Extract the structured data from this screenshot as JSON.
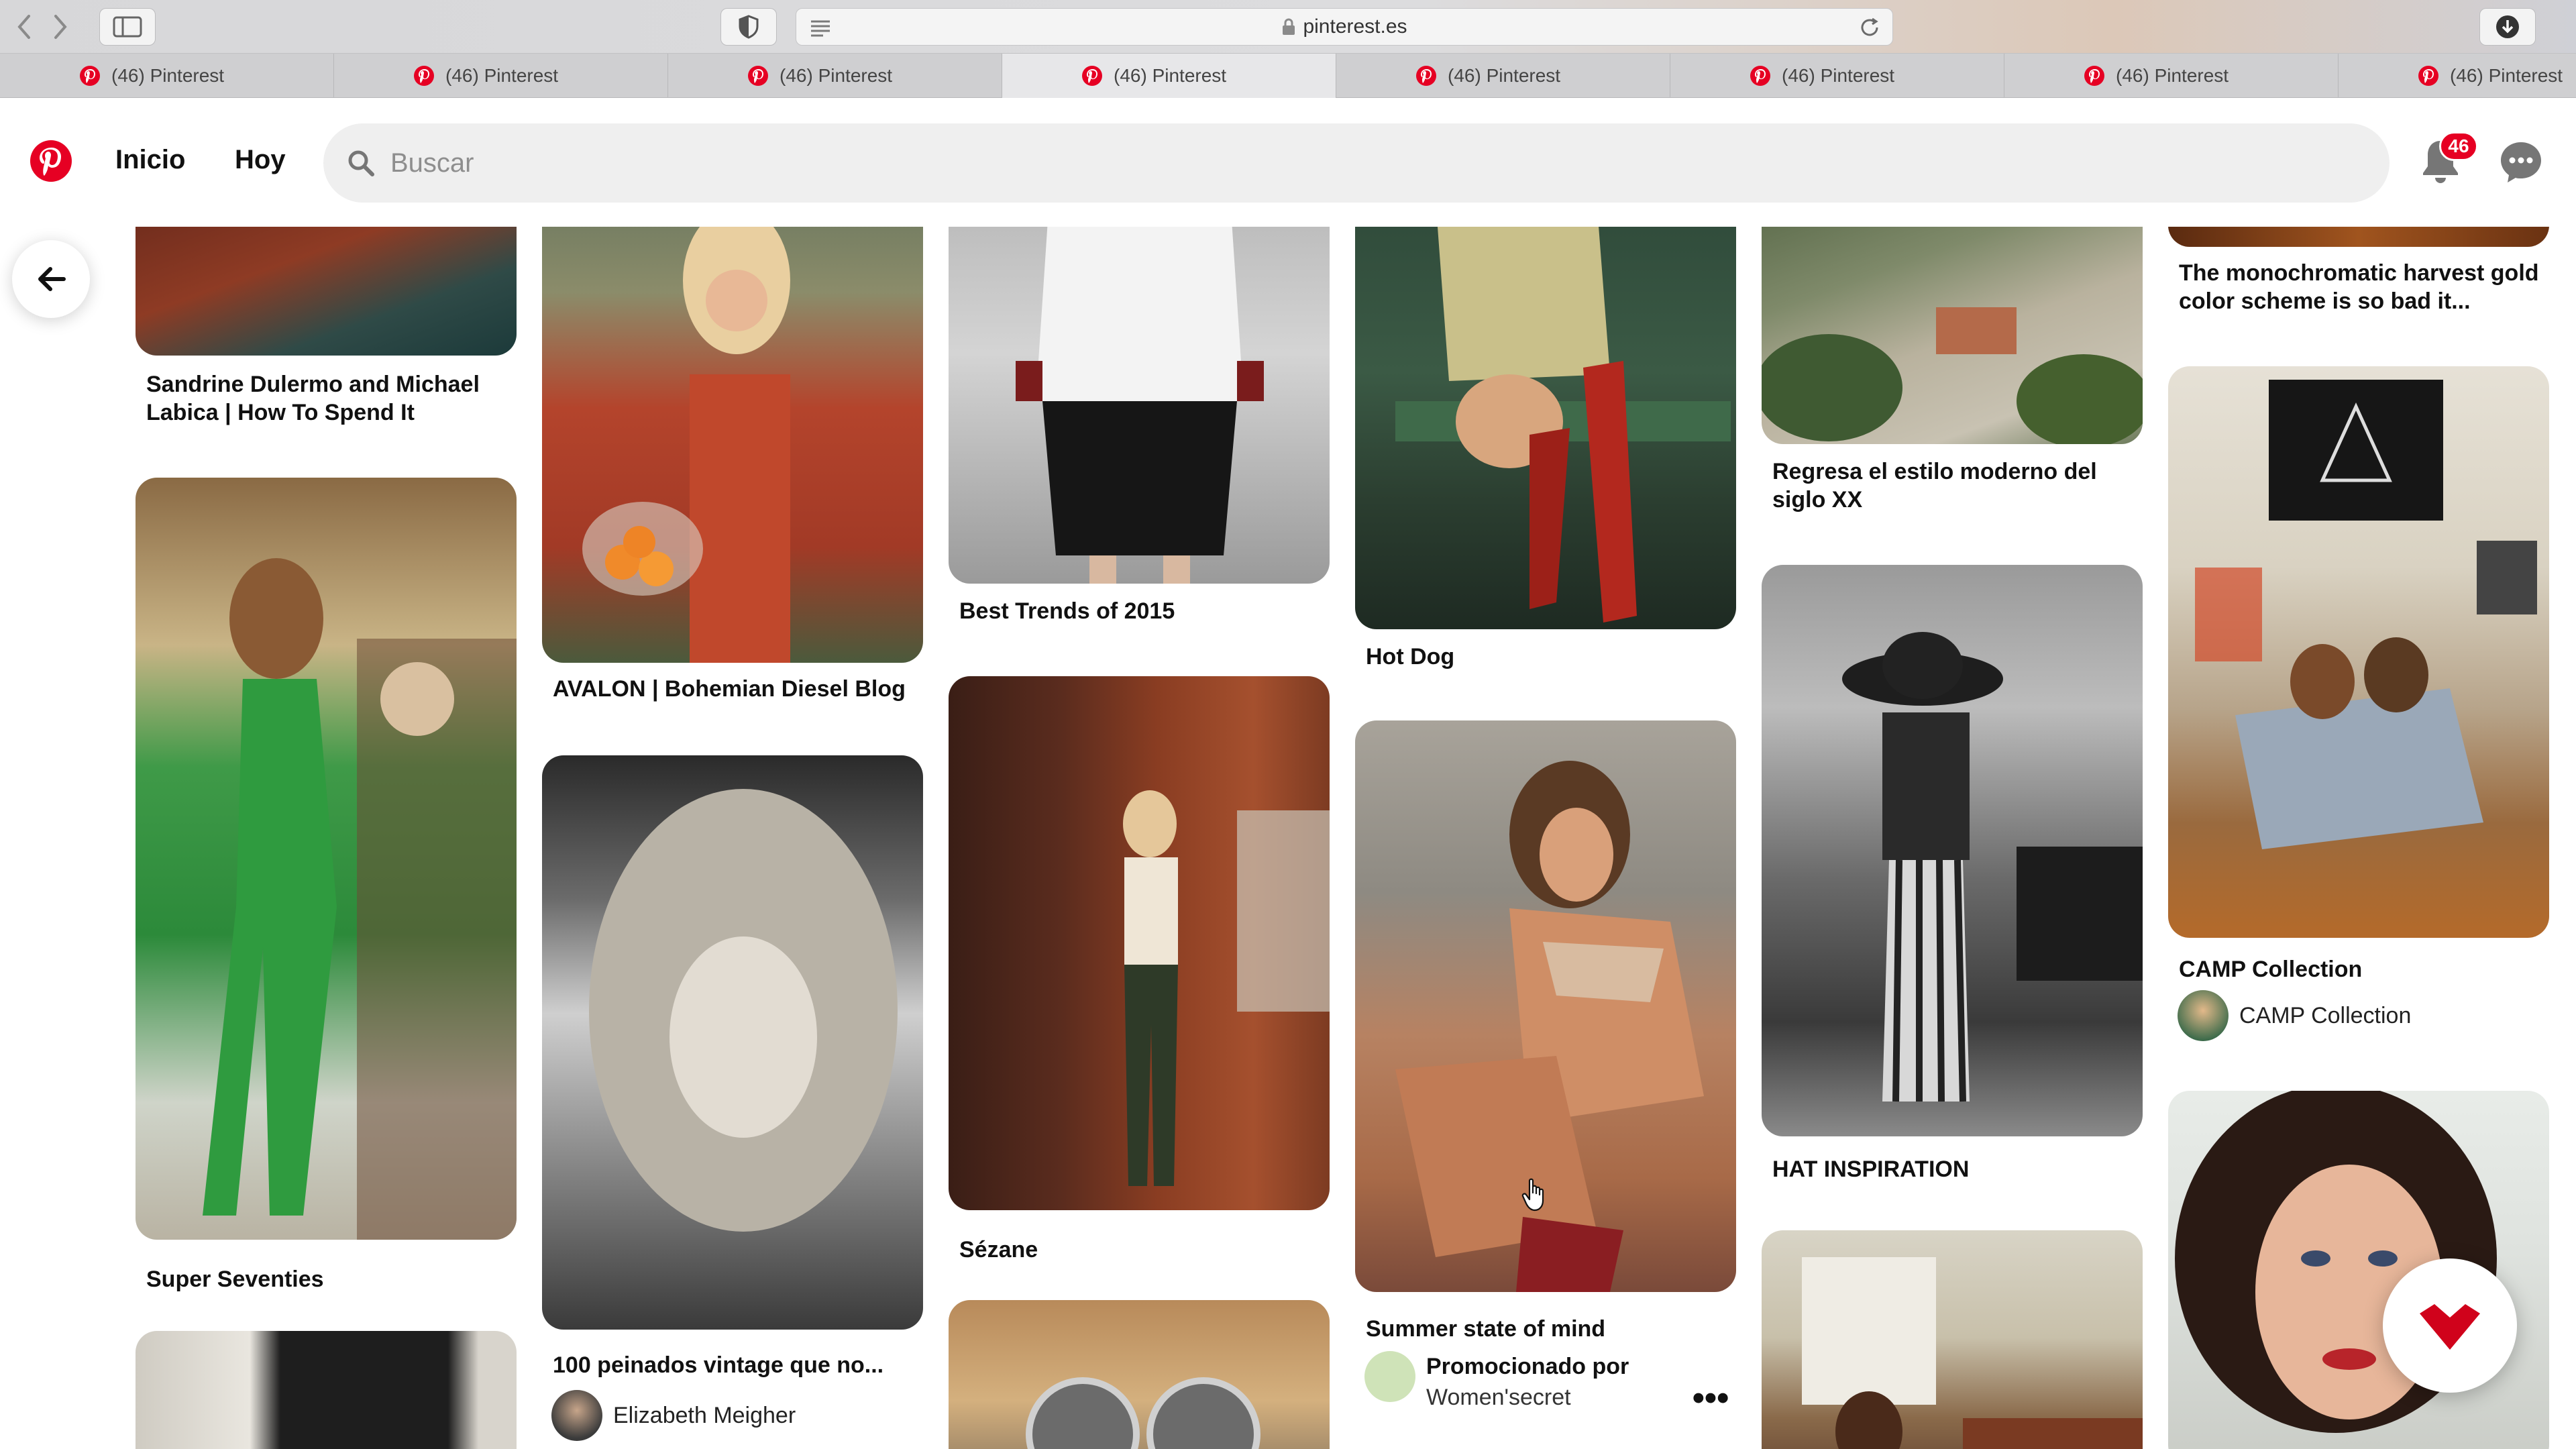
{
  "browser": {
    "url": "pinterest.es",
    "tabs": [
      {
        "label": "(46) Pinterest",
        "active": false
      },
      {
        "label": "(46) Pinterest",
        "active": false
      },
      {
        "label": "(46) Pinterest",
        "active": false
      },
      {
        "label": "(46) Pinterest",
        "active": true
      },
      {
        "label": "(46) Pinterest",
        "active": false
      },
      {
        "label": "(46) Pinterest",
        "active": false
      },
      {
        "label": "(46) Pinterest",
        "active": false
      },
      {
        "label": "(46) Pinterest",
        "active": false
      }
    ]
  },
  "header": {
    "nav_home": "Inicio",
    "nav_today": "Hoy",
    "search_placeholder": "Buscar",
    "notification_count": "46",
    "brand_color": "#e60023"
  },
  "feed": {
    "pins": {
      "sandrine": {
        "title": "Sandrine Dulermo and Michael Labica | How To Spend It"
      },
      "super_seventies": {
        "title": "Super Seventies"
      },
      "avalon": {
        "title": "AVALON | Bohemian Diesel Blog"
      },
      "peinados": {
        "title": "100 peinados vintage que no...",
        "creator": "Elizabeth Meigher"
      },
      "best_trends": {
        "title": "Best Trends of 2015"
      },
      "sezane": {
        "title": "Sézane"
      },
      "hot_dog": {
        "title": "Hot Dog"
      },
      "summer": {
        "title": "Summer state of mind",
        "promoted_label": "Promocionado por",
        "promoter": "Women'secret"
      },
      "regresa": {
        "title": "Regresa el estilo moderno del siglo XX"
      },
      "hat": {
        "title": "HAT INSPIRATION"
      },
      "monochromatic": {
        "title": "The monochromatic harvest gold color scheme is so bad it..."
      },
      "camp": {
        "title": "CAMP Collection",
        "creator": "CAMP Collection"
      }
    }
  }
}
